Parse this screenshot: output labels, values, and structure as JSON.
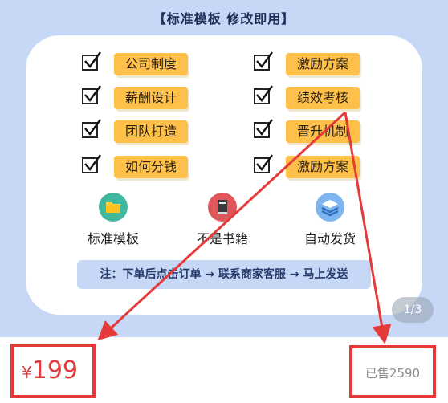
{
  "banner": {
    "title": "【标准模板  修改即用】"
  },
  "checklist": {
    "left": [
      "公司制度",
      "薪酬设计",
      "团队打造",
      "如何分钱"
    ],
    "right": [
      "激励方案",
      "绩效考核",
      "晋升机制",
      "激励方案"
    ]
  },
  "features": [
    {
      "label": "标准模板",
      "icon": "folder-icon",
      "color": "#3fb8a0"
    },
    {
      "label": "不是书籍",
      "icon": "book-icon",
      "color": "#e0575b"
    },
    {
      "label": "自动发货",
      "icon": "layers-icon",
      "color": "#7fb5ef"
    }
  ],
  "notice": "注：下单后点击订单 → 联系商家客服 → 马上发送",
  "pager": "1/3",
  "price": {
    "currency": "¥",
    "amount": "199"
  },
  "sold": "已售2590",
  "colors": {
    "accent": "#ffc04a",
    "banner": "#c6d8f5",
    "highlight": "#e53a3a"
  }
}
